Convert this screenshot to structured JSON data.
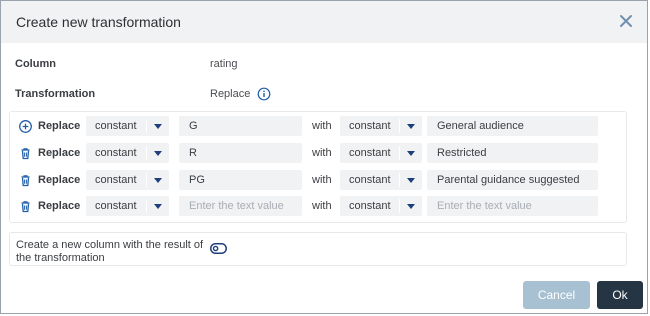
{
  "dialog": {
    "title": "Create new transformation",
    "column_label": "Column",
    "column_value": "rating",
    "transformation_label": "Transformation",
    "transformation_value": "Replace"
  },
  "rules": [
    {
      "icon": "add-circle-icon",
      "label": "Replace",
      "from_type": "constant",
      "from_value": "G",
      "placeholder": "",
      "with_label": "with",
      "to_type": "constant",
      "to_value": "General audience",
      "to_placeholder": ""
    },
    {
      "icon": "trash-icon",
      "label": "Replace",
      "from_type": "constant",
      "from_value": "R",
      "placeholder": "",
      "with_label": "with",
      "to_type": "constant",
      "to_value": "Restricted",
      "to_placeholder": ""
    },
    {
      "icon": "trash-icon",
      "label": "Replace",
      "from_type": "constant",
      "from_value": "PG",
      "placeholder": "",
      "with_label": "with",
      "to_type": "constant",
      "to_value": "Parental guidance suggested",
      "to_placeholder": ""
    },
    {
      "icon": "trash-icon",
      "label": "Replace",
      "from_type": "constant",
      "from_value": "",
      "placeholder": "Enter the text value",
      "with_label": "with",
      "to_type": "constant",
      "to_value": "",
      "to_placeholder": "Enter the text value"
    }
  ],
  "toggle": {
    "label": "Create a new column with the result of the transformation",
    "enabled": false
  },
  "buttons": {
    "cancel": "Cancel",
    "ok": "Ok"
  },
  "colors": {
    "accent": "#1f3f7a",
    "cancel_bg": "#a7c1d3",
    "ok_bg": "#253544",
    "field_bg": "#f1f2f4"
  }
}
